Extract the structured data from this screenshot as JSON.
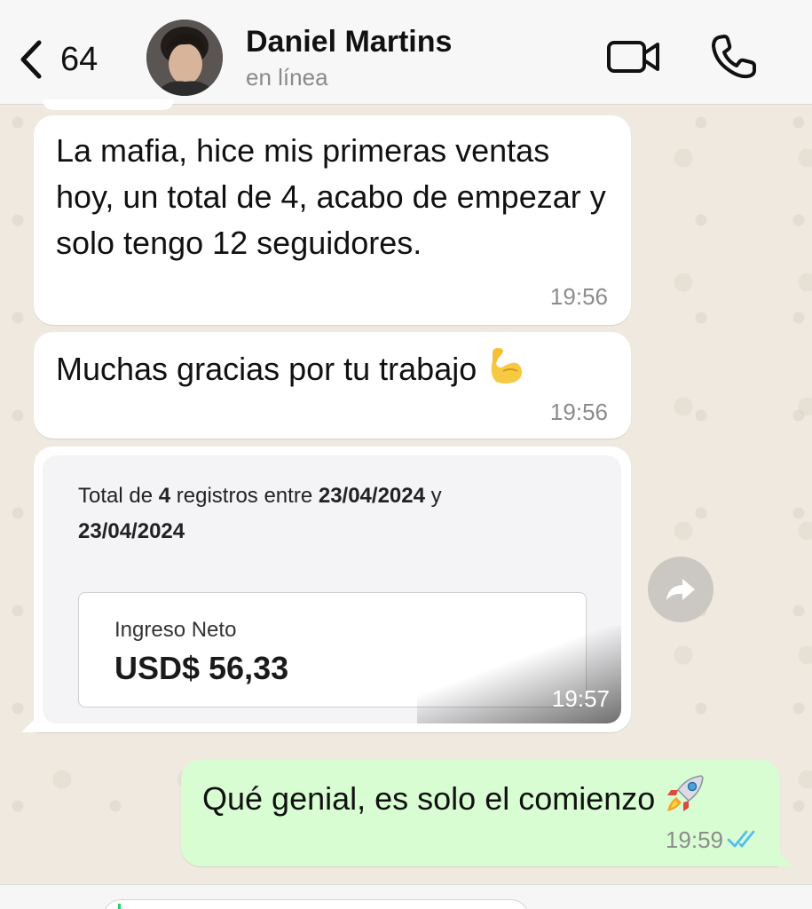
{
  "header": {
    "back_count": "64",
    "contact_name": "Daniel Martins",
    "contact_status": "en línea"
  },
  "messages": [
    {
      "direction": "incoming",
      "text": "La mafia, hice mis primeras ventas hoy, un total de 4, acabo de empezar y solo tengo 12 seguidores.",
      "time": "19:56"
    },
    {
      "direction": "incoming",
      "text": "Muchas gracias por tu trabajo",
      "emoji": "flexed-biceps",
      "time": "19:56"
    },
    {
      "direction": "incoming",
      "type": "image",
      "time": "19:57",
      "image": {
        "summary_prefix": "Total de",
        "summary_count": "4",
        "summary_mid": "registros entre",
        "date_start": "23/04/2024",
        "summary_and": "y",
        "date_end": "23/04/2024",
        "net_label": "Ingreso Neto",
        "net_value": "USD$ 56,33"
      }
    },
    {
      "direction": "outgoing",
      "text": "Qué genial, es solo el comienzo",
      "emoji": "rocket",
      "time": "19:59",
      "status": "read"
    }
  ],
  "colors": {
    "incoming_bubble": "#ffffff",
    "outgoing_bubble": "#d9fdd3",
    "read_ticks": "#53bdeb",
    "wallpaper": "#efeae2"
  }
}
